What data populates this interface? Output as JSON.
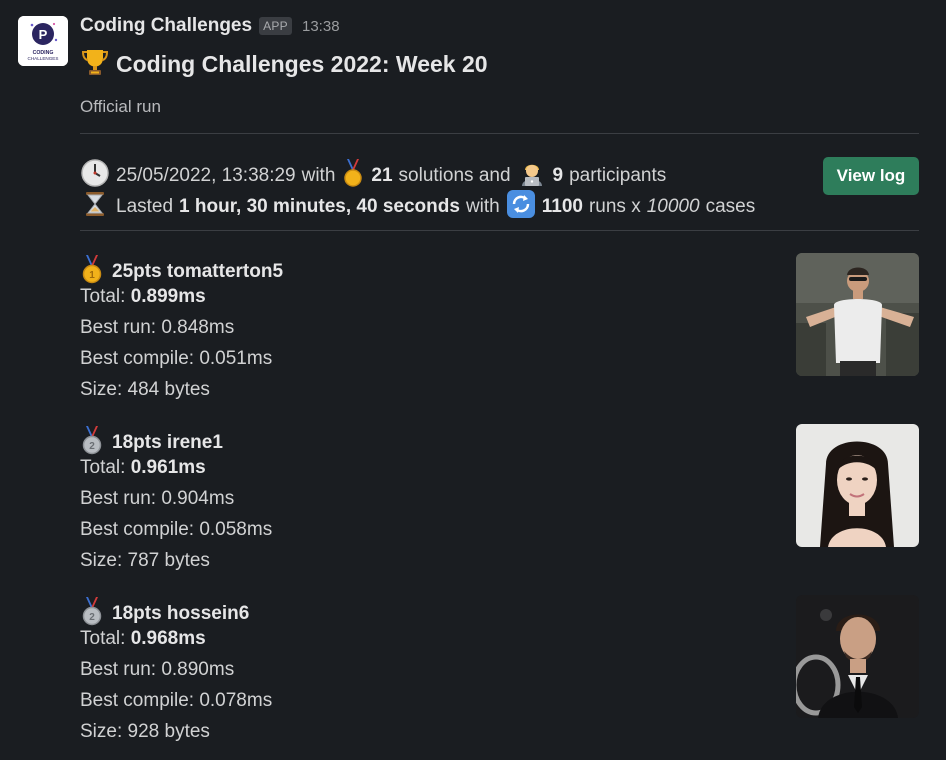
{
  "app": {
    "name": "Coding Challenges",
    "badge": "APP",
    "time": "13:38",
    "logo_text": "CODING\nCHALLENGES"
  },
  "message": {
    "title": "Coding Challenges 2022: Week 20",
    "subtitle": "Official run"
  },
  "summary": {
    "date": "25/05/2022, 13:38:29",
    "with1": "with",
    "solutions_count": "21",
    "solutions_label": "solutions and",
    "participants_count": "9",
    "participants_label": "participants",
    "lasted_label": "Lasted",
    "duration": "1 hour, 30 minutes, 40 seconds",
    "with2": "with",
    "runs_count": "1100",
    "runs_label": "runs x",
    "cases_count": "10000",
    "cases_label": "cases"
  },
  "view_log_label": "View log",
  "entries": [
    {
      "title": "25pts tomatterton5",
      "medal": "gold",
      "total_label": "Total:",
      "total": "0.899ms",
      "best_run": "Best run: 0.848ms",
      "best_compile": "Best compile: 0.051ms",
      "size": "Size: 484 bytes"
    },
    {
      "title": "18pts irene1",
      "medal": "silver",
      "total_label": "Total:",
      "total": "0.961ms",
      "best_run": "Best run: 0.904ms",
      "best_compile": "Best compile: 0.058ms",
      "size": "Size: 787 bytes"
    },
    {
      "title": "18pts hossein6",
      "medal": "silver",
      "total_label": "Total:",
      "total": "0.968ms",
      "best_run": "Best run: 0.890ms",
      "best_compile": "Best compile: 0.078ms",
      "size": "Size: 928 bytes"
    }
  ],
  "icons": {
    "trophy": "trophy-icon",
    "clock": "clock-icon",
    "medal": "medal-icon",
    "technologist": "technologist-icon",
    "hourglass": "hourglass-icon",
    "repeat": "repeat-icon"
  },
  "colors": {
    "background": "#1a1d21",
    "button": "#2e7d5b",
    "gold": "#f2b21a",
    "silver": "#a8acb1"
  }
}
